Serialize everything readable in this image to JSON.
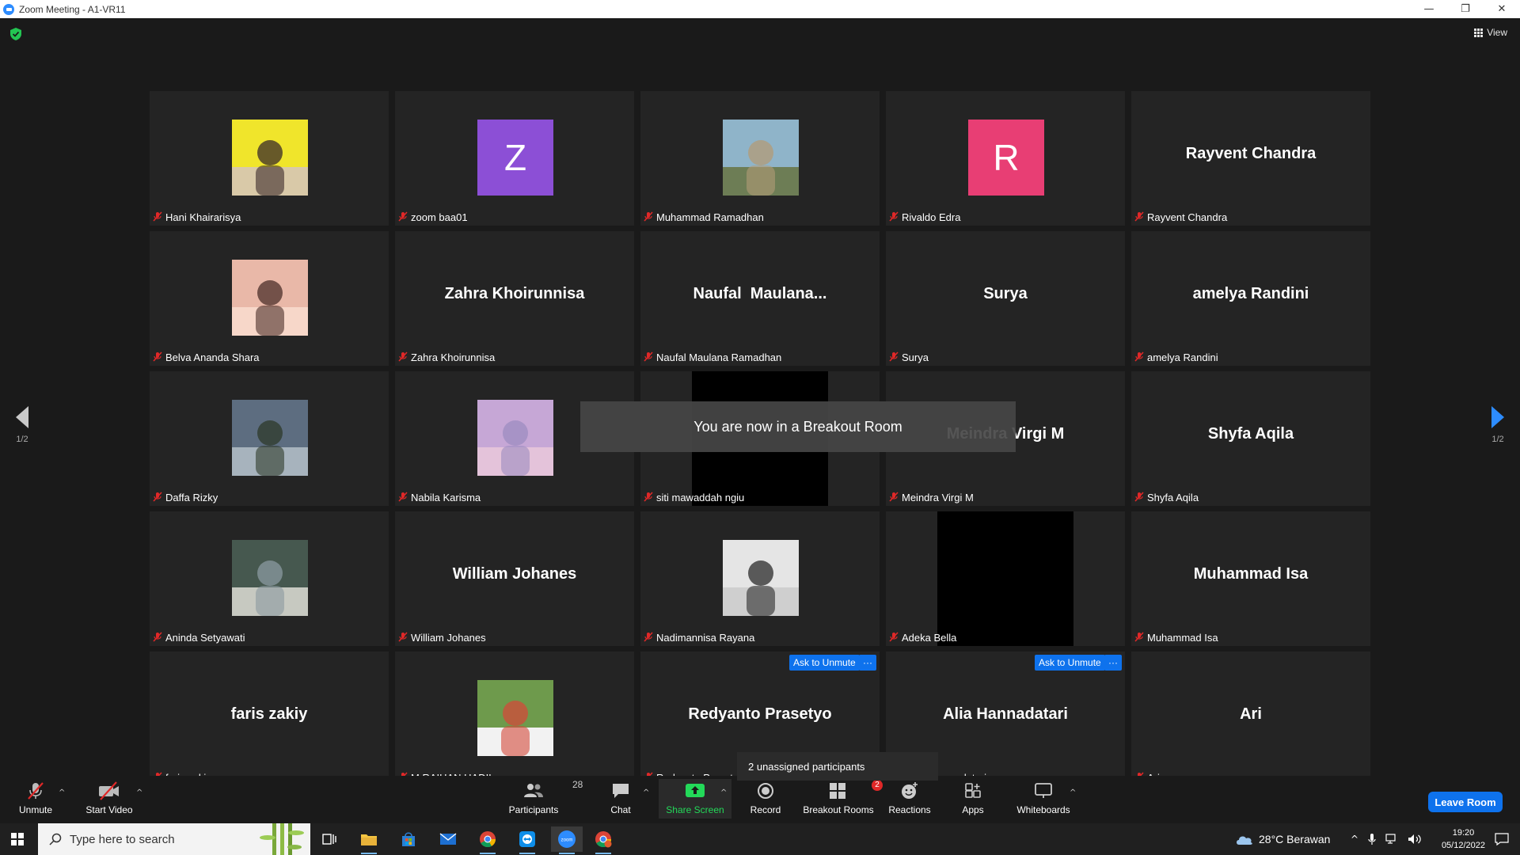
{
  "window": {
    "title": "Zoom Meeting - A1-VR11",
    "minimize": "—",
    "restore": "❐",
    "close": "✕"
  },
  "header": {
    "view_label": "View"
  },
  "pagination": {
    "left": "1/2",
    "right": "1/2"
  },
  "tiles": [
    {
      "name": "Hani Khairarisya",
      "display": "photo"
    },
    {
      "name": "zoom baa01",
      "display": "letter",
      "letter": "Z",
      "color": "#8c4fd6"
    },
    {
      "name": "Muhammad Ramadhan",
      "display": "photo"
    },
    {
      "name": "Rivaldo Edra",
      "display": "letter",
      "letter": "R",
      "color": "#e83e74"
    },
    {
      "name": "Rayvent Chandra",
      "display": "text",
      "big": "Rayvent Chandra"
    },
    {
      "name": "Belva Ananda Shara",
      "display": "photo"
    },
    {
      "name": "Zahra Khoirunnisa",
      "display": "text",
      "big": "Zahra Khoirunnisa"
    },
    {
      "name": "Naufal Maulana Ramadhan",
      "display": "text",
      "big": "Naufal  Maulana..."
    },
    {
      "name": "Surya",
      "display": "text",
      "big": "Surya"
    },
    {
      "name": "amelya Randini",
      "display": "text",
      "big": "amelya Randini"
    },
    {
      "name": "Daffa Rizky",
      "display": "photo"
    },
    {
      "name": "Nabila Karisma",
      "display": "photo"
    },
    {
      "name": "siti mawaddah ngiu",
      "display": "video"
    },
    {
      "name": "Meindra Virgi M",
      "display": "text",
      "big": "Meindra Virgi M"
    },
    {
      "name": "Shyfa Aqila",
      "display": "text",
      "big": "Shyfa Aqila"
    },
    {
      "name": "Aninda Setyawati",
      "display": "photo"
    },
    {
      "name": "William Johanes",
      "display": "text",
      "big": "William Johanes"
    },
    {
      "name": "Nadimannisa Rayana",
      "display": "photo"
    },
    {
      "name": "Adeka Bella",
      "display": "video"
    },
    {
      "name": "Muhammad Isa",
      "display": "text",
      "big": "Muhammad Isa"
    },
    {
      "name": "faris zakiy",
      "display": "text",
      "big": "faris zakiy"
    },
    {
      "name": "M.RAIHAN HADIL",
      "display": "photo"
    },
    {
      "name": "Redyanto Prasety",
      "display": "text",
      "big": "Redyanto Prasetyo",
      "ask": "Ask to Unmute"
    },
    {
      "name": "nadatari",
      "display": "text",
      "big": "Alia Hannadatari",
      "ask": "Ask to Unmute"
    },
    {
      "name": "Ari",
      "display": "text",
      "big": "Ari"
    }
  ],
  "more_label": "···",
  "toast": "You are now in a Breakout Room",
  "tooltip": "2 unassigned participants",
  "toolbar": {
    "unmute": "Unmute",
    "start_video": "Start Video",
    "participants": "Participants",
    "participants_count": "28",
    "chat": "Chat",
    "share_screen": "Share Screen",
    "record": "Record",
    "breakout_rooms": "Breakout Rooms",
    "breakout_count": "2",
    "reactions": "Reactions",
    "apps": "Apps",
    "whiteboards": "Whiteboards",
    "leave": "Leave Room"
  },
  "taskbar": {
    "search_placeholder": "Type here to search",
    "weather": "28°C  Berawan",
    "time": "19:20",
    "date": "05/12/2022"
  },
  "colors": {
    "accent": "#0e72ed",
    "share_green": "#23d959",
    "mic_red": "#e02828"
  }
}
